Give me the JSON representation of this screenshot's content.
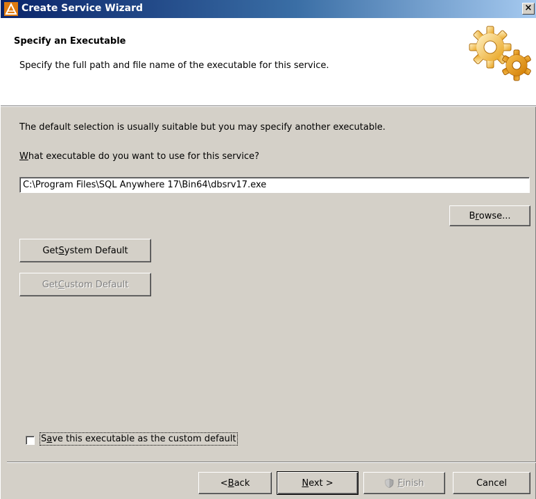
{
  "window": {
    "title": "Create Service Wizard",
    "close_glyph": "×"
  },
  "header": {
    "title": "Specify an Executable",
    "description": "Specify the full path and file name of the executable for this service.",
    "icon": "gears-icon"
  },
  "body": {
    "intro_text": "The default selection is usually suitable but you may specify another executable.",
    "question_mnemonic": "W",
    "question_rest": "hat executable do you want to use for this service?",
    "executable_path": "C:\\Program Files\\SQL Anywhere 17\\Bin64\\dbsrv17.exe",
    "browse": {
      "pre": "B",
      "mn": "r",
      "post": "owse..."
    },
    "get_system_default": {
      "pre": "Get ",
      "mn": "S",
      "post": "ystem Default"
    },
    "get_custom_default": {
      "pre": "Get ",
      "mn": "C",
      "post": "ustom Default",
      "disabled": true
    },
    "save_checkbox": {
      "pre": "S",
      "mn": "a",
      "post": "ve this executable as the custom default",
      "checked": false
    }
  },
  "footer": {
    "back": {
      "pre": "< ",
      "mn": "B",
      "post": "ack"
    },
    "next": {
      "pre": "",
      "mn": "N",
      "post": "ext >"
    },
    "finish": {
      "pre": "",
      "mn": "F",
      "post": "inish",
      "disabled": true,
      "icon": "shield-icon"
    },
    "cancel": "Cancel"
  },
  "colors": {
    "title_gradient_start": "#0a246a",
    "title_gradient_end": "#a6caf0",
    "dialog_face": "#d4d0c8",
    "gear_orange": "#f5a623"
  }
}
